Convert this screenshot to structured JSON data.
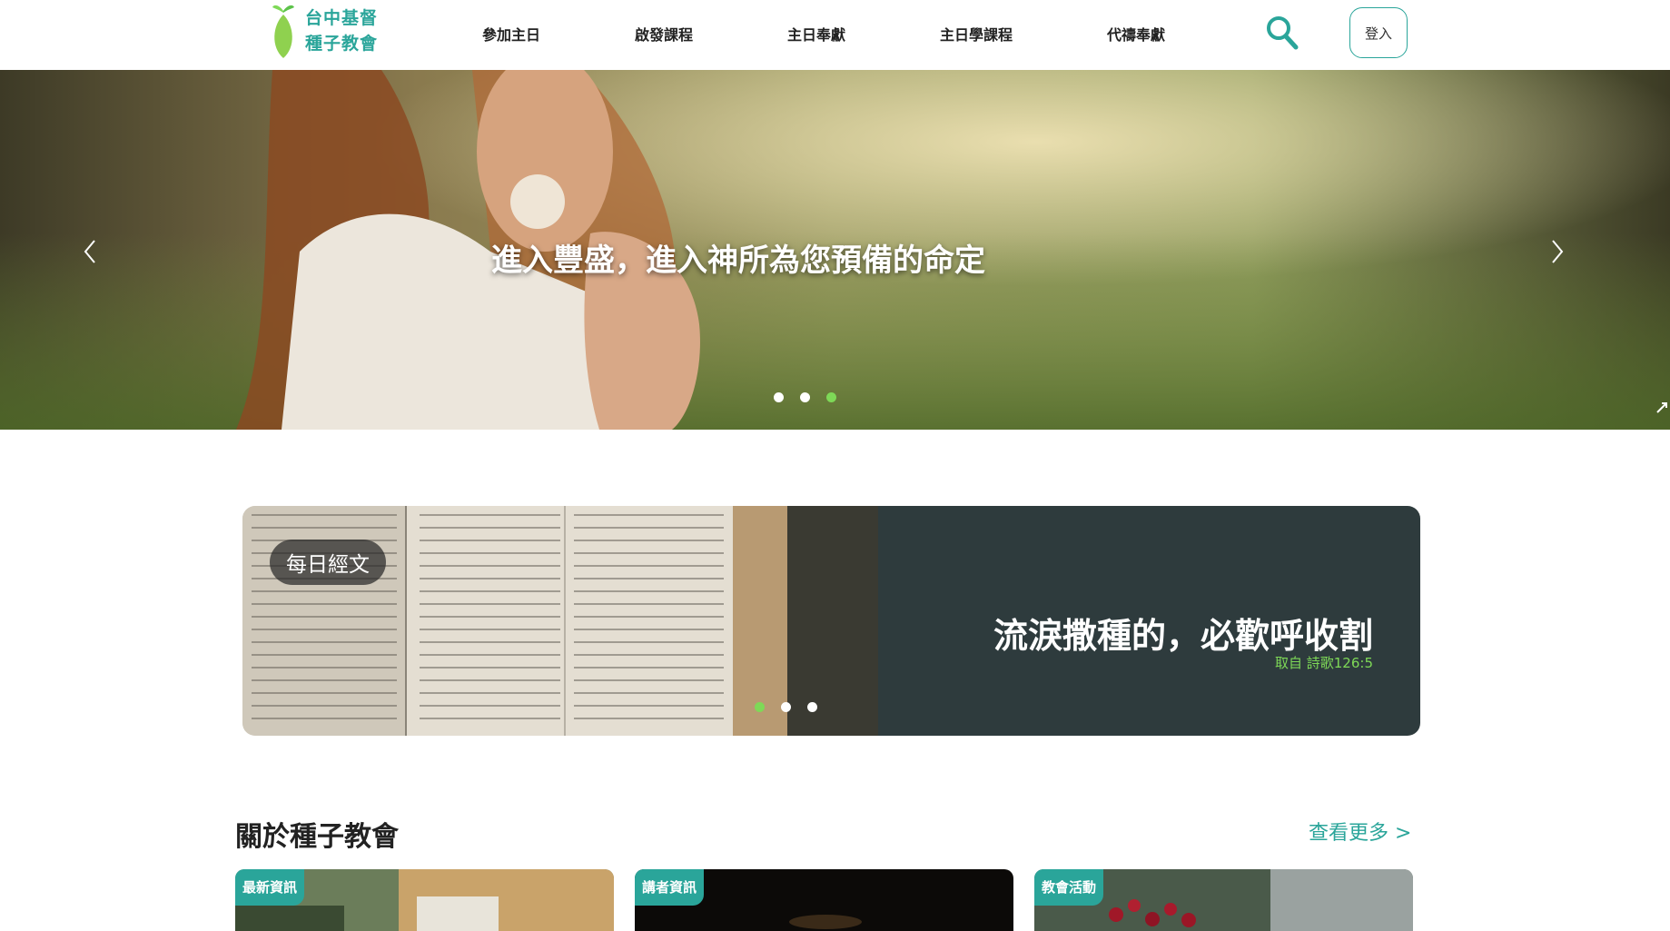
{
  "header": {
    "logo_line1": "台中基督",
    "logo_line2": "種子教會",
    "nav": [
      "參加主日",
      "啟發課程",
      "主日奉獻",
      "主日學課程",
      "代禱奉獻"
    ],
    "login_label": "登入"
  },
  "hero": {
    "title": "進入豐盛，進入神所為您預備的命定",
    "slides_count": 3,
    "active_slide": 3
  },
  "verse": {
    "tag": "每日經文",
    "text": "流淚撒種的，必歡呼收割",
    "source": "取自 詩歌126:5",
    "slides_count": 3,
    "active_slide": 1
  },
  "about": {
    "title": "關於種子教會",
    "more_label": "查看更多 >",
    "cards": [
      {
        "tag": "最新資訊"
      },
      {
        "tag": "講者資訊"
      },
      {
        "tag": "教會活動"
      }
    ]
  },
  "colors": {
    "accent": "#2aa59a",
    "dot_active": "#7ed957"
  }
}
